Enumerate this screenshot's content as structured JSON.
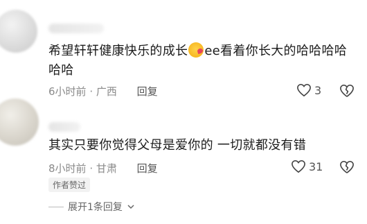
{
  "comments": [
    {
      "text_before_emoji": "希望轩轩健康快乐的成长",
      "emoji": "kiss-face-emoji",
      "text_after_emoji_line1": "ee看着你长大的哈哈哈哈",
      "text_line2": "哈哈",
      "time": "6小时前",
      "location": "广西",
      "reply_label": "回复",
      "likes": "3"
    },
    {
      "text": "其实只要你觉得父母是爱你的 一切就都没有错",
      "time": "8小时前",
      "location": "甘肃",
      "reply_label": "回复",
      "likes": "31",
      "badge": "作者赞过"
    }
  ],
  "expand_replies": "展开1条回复",
  "colors": {
    "text": "#1c1c1c",
    "meta": "#8a8a8a"
  }
}
